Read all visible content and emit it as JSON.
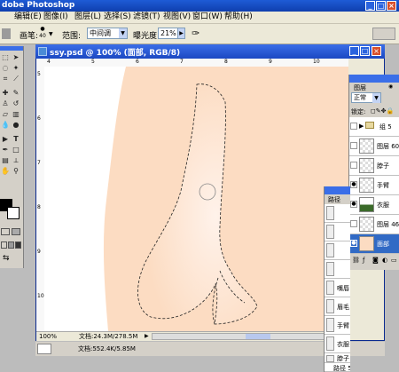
{
  "app": {
    "title": "dobe Photoshop"
  },
  "menubar": {
    "items": [
      "编辑(E)",
      "图像(I)",
      "图层(L)",
      "选择(S)",
      "滤镜(T)",
      "视图(V)",
      "窗口(W)",
      "帮助(H)"
    ]
  },
  "options": {
    "brush_label": "画笔:",
    "brush_size": "40",
    "range_label": "范围:",
    "range_value": "中间调",
    "exposure_label": "曝光度:",
    "exposure_value": "21%"
  },
  "document": {
    "title": "ssy.psd @ 100% (面部, RGB/8)",
    "ruler_top": [
      "4",
      "5",
      "6",
      "7",
      "8",
      "9",
      "10"
    ],
    "ruler_left": [
      "5",
      "6",
      "7",
      "8",
      "9",
      "10"
    ],
    "zoom": "100%",
    "doc_size": "文档:24.3M/278.5M"
  },
  "status": {
    "doc_size": "文档:552.4K/5.85M"
  },
  "layers_panel": {
    "tab": "图层",
    "blend_mode": "正常",
    "lock_label": "锁定:",
    "layers": [
      {
        "name": "组 5",
        "visible": false
      },
      {
        "name": "图层 60",
        "visible": false
      },
      {
        "name": "脖子",
        "visible": false
      },
      {
        "name": "手臂",
        "visible": true
      },
      {
        "name": "衣服",
        "visible": true
      },
      {
        "name": "图层 46 ...",
        "visible": false
      },
      {
        "name": "面部",
        "visible": true,
        "selected": true
      }
    ]
  },
  "paths_panel": {
    "tab": "路径",
    "paths": [
      "",
      "",
      "",
      "",
      "嘴唇",
      "眉毛",
      "手臂",
      "衣服",
      "脖子",
      "路径 5"
    ]
  },
  "colors": {
    "skin": "#fcdcc2",
    "xp_blue": "#1e5bd6",
    "selected_layer": "#316ac5"
  }
}
